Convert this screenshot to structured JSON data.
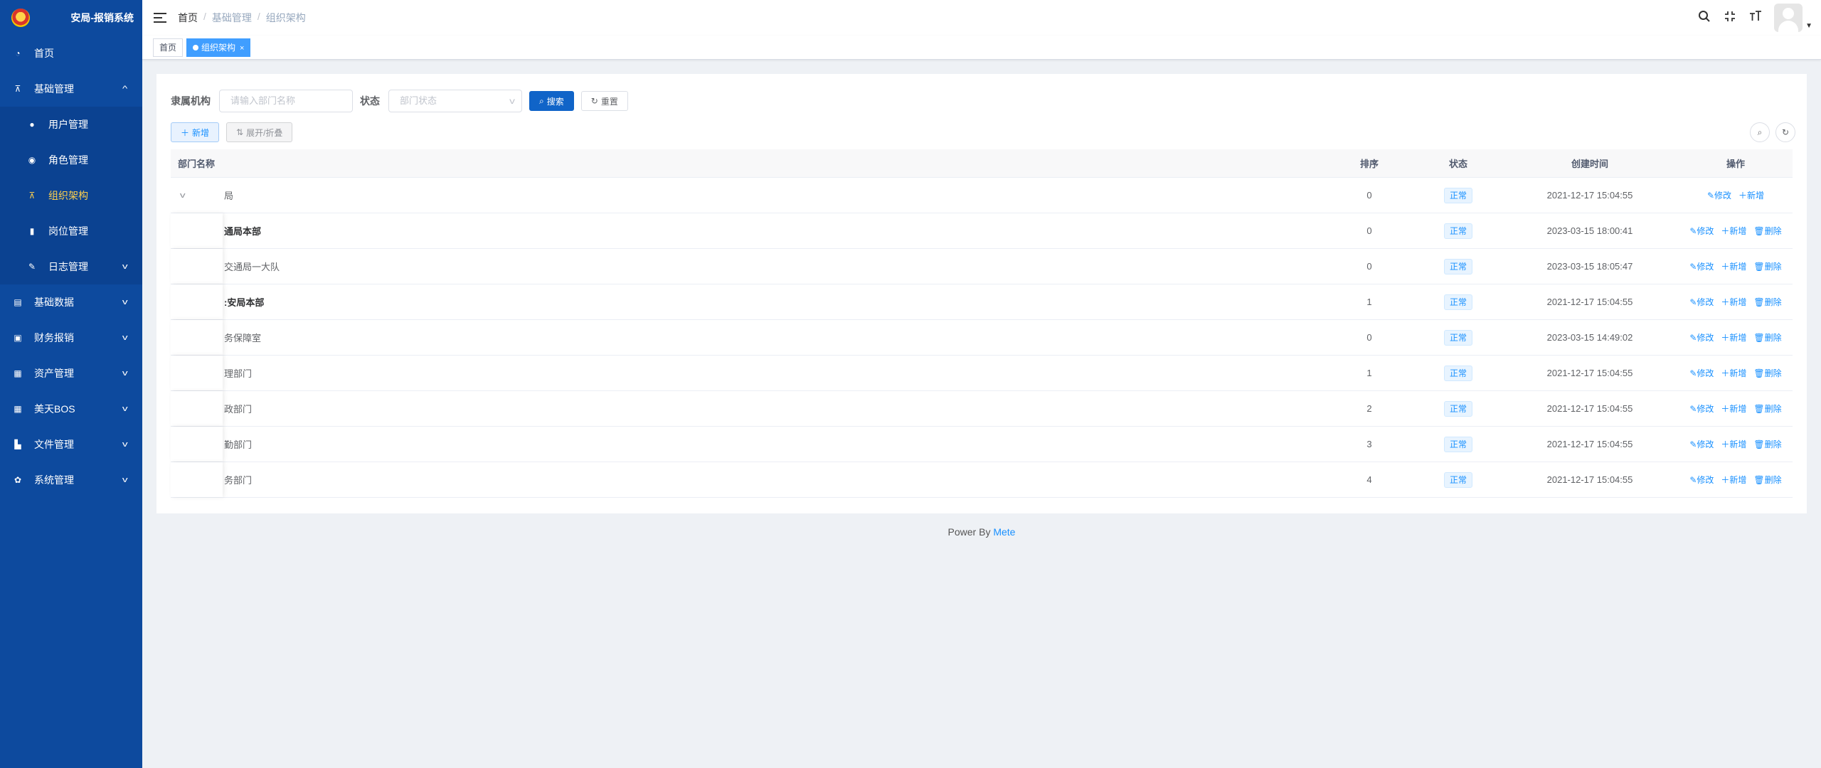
{
  "app": {
    "title": "安局-报销系统"
  },
  "sidebar": {
    "items": [
      {
        "label": "首页",
        "icon": "dashboard-icon"
      },
      {
        "label": "基础管理",
        "icon": "tree-icon",
        "expanded": true,
        "children": [
          {
            "label": "用户管理",
            "icon": "user-icon"
          },
          {
            "label": "角色管理",
            "icon": "peoples-icon"
          },
          {
            "label": "组织架构",
            "icon": "tree-icon",
            "active": true
          },
          {
            "label": "岗位管理",
            "icon": "post-icon"
          },
          {
            "label": "日志管理",
            "icon": "log-icon"
          }
        ]
      },
      {
        "label": "基础数据",
        "icon": "table-icon"
      },
      {
        "label": "财务报销",
        "icon": "money-icon"
      },
      {
        "label": "资产管理",
        "icon": "box-icon"
      },
      {
        "label": "美天BOS",
        "icon": "grid-icon"
      },
      {
        "label": "文件管理",
        "icon": "file-icon"
      },
      {
        "label": "系统管理",
        "icon": "gear-icon"
      }
    ]
  },
  "header": {
    "breadcrumb": [
      "首页",
      "基础管理",
      "组织架构"
    ]
  },
  "tags": [
    {
      "label": "首页",
      "active": false
    },
    {
      "label": "组织架构",
      "active": true,
      "close": "×"
    }
  ],
  "search": {
    "dept_label": "隶属机构",
    "dept_placeholder": "请输入部门名称",
    "status_label": "状态",
    "status_placeholder": "部门状态",
    "search_btn": "搜索",
    "reset_btn": "重置"
  },
  "toolbar": {
    "add_btn": "新增",
    "toggle_btn": "展开/折叠"
  },
  "table": {
    "headers": {
      "name": "部门名称",
      "sort": "排序",
      "status": "状态",
      "time": "创建时间",
      "ops": "操作"
    },
    "op_labels": {
      "edit": "修改",
      "add": "新增",
      "delete": "删除"
    },
    "rows": [
      {
        "name": "局",
        "sort": "0",
        "status": "正常",
        "time": "2021-12-17 15:04:55",
        "root": true
      },
      {
        "name": "通局本部",
        "sort": "0",
        "status": "正常",
        "time": "2023-03-15 18:00:41",
        "bold": true
      },
      {
        "name": "交通局一大队",
        "sort": "0",
        "status": "正常",
        "time": "2023-03-15 18:05:47"
      },
      {
        "name": ":安局本部",
        "sort": "1",
        "status": "正常",
        "time": "2021-12-17 15:04:55",
        "bold": true
      },
      {
        "name": "务保障室",
        "sort": "0",
        "status": "正常",
        "time": "2023-03-15 14:49:02"
      },
      {
        "name": "理部门",
        "sort": "1",
        "status": "正常",
        "time": "2021-12-17 15:04:55"
      },
      {
        "name": "政部门",
        "sort": "2",
        "status": "正常",
        "time": "2021-12-17 15:04:55"
      },
      {
        "name": "勤部门",
        "sort": "3",
        "status": "正常",
        "time": "2021-12-17 15:04:55"
      },
      {
        "name": "务部门",
        "sort": "4",
        "status": "正常",
        "time": "2021-12-17 15:04:55"
      }
    ]
  },
  "footer": {
    "prefix": "Power By",
    "link": "Mete"
  }
}
